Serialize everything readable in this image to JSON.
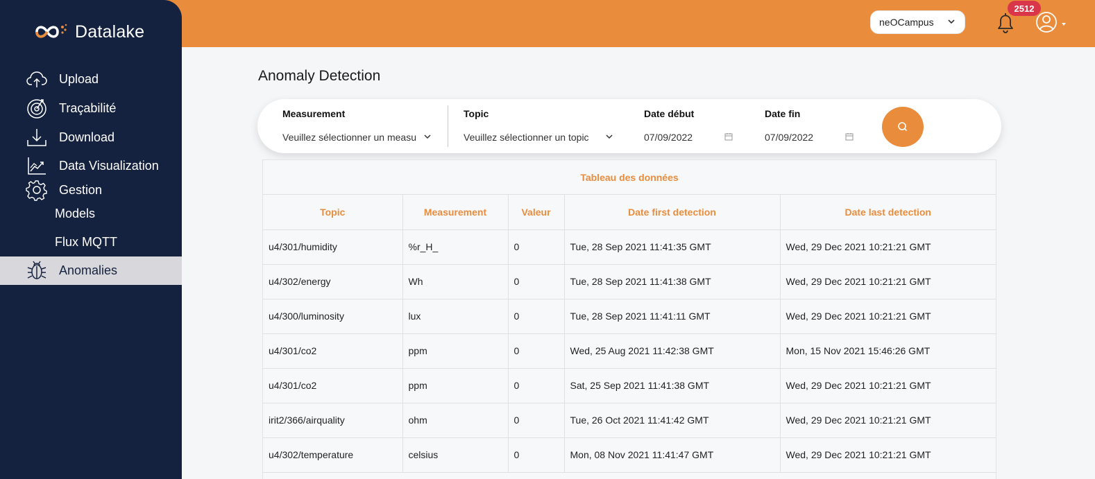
{
  "sidebar": {
    "logo_text": "Datalake",
    "items": [
      {
        "label": "Upload",
        "icon": "cloud-upload-icon"
      },
      {
        "label": "Traçabilité",
        "icon": "target-icon"
      },
      {
        "label": "Download",
        "icon": "download-icon"
      },
      {
        "label": "Data Visualization",
        "icon": "chart-icon"
      },
      {
        "label": "Gestion",
        "icon": "gear-icon"
      }
    ],
    "sub_items": [
      {
        "label": "Models"
      },
      {
        "label": "Flux MQTT"
      }
    ],
    "active_item": {
      "label": "Anomalies",
      "icon": "bug-icon"
    }
  },
  "header": {
    "org_select_value": "neOCampus",
    "notification_count": "2512"
  },
  "page": {
    "title": "Anomaly Detection"
  },
  "filters": {
    "measurement_label": "Measurement",
    "measurement_placeholder": "Veuillez sélectionner un measurement",
    "topic_label": "Topic",
    "topic_placeholder": "Veuillez sélectionner un topic",
    "date_start_label": "Date début",
    "date_start_value": "07/09/2022",
    "date_end_label": "Date fin",
    "date_end_value": "07/09/2022"
  },
  "table": {
    "caption": "Tableau des données",
    "headers": [
      "Topic",
      "Measurement",
      "Valeur",
      "Date first detection",
      "Date last detection"
    ],
    "rows": [
      [
        "u4/301/humidity",
        "%r_H_",
        "0",
        "Tue, 28 Sep 2021 11:41:35 GMT",
        "Wed, 29 Dec 2021 10:21:21 GMT"
      ],
      [
        "u4/302/energy",
        "Wh",
        "0",
        "Tue, 28 Sep 2021 11:41:38 GMT",
        "Wed, 29 Dec 2021 10:21:21 GMT"
      ],
      [
        "u4/300/luminosity",
        "lux",
        "0",
        "Tue, 28 Sep 2021 11:41:11 GMT",
        "Wed, 29 Dec 2021 10:21:21 GMT"
      ],
      [
        "u4/301/co2",
        "ppm",
        "0",
        "Wed, 25 Aug 2021 11:42:38 GMT",
        "Mon, 15 Nov 2021 15:46:26 GMT"
      ],
      [
        "u4/301/co2",
        "ppm",
        "0",
        "Sat, 25 Sep 2021 11:41:38 GMT",
        "Wed, 29 Dec 2021 10:21:21 GMT"
      ],
      [
        "irit2/366/airquality",
        "ohm",
        "0",
        "Tue, 26 Oct 2021 11:41:42 GMT",
        "Wed, 29 Dec 2021 10:21:21 GMT"
      ],
      [
        "u4/302/temperature",
        "celsius",
        "0",
        "Mon, 08 Nov 2021 11:41:47 GMT",
        "Wed, 29 Dec 2021 10:21:21 GMT"
      ]
    ]
  },
  "colors": {
    "accent": "#e98c3c",
    "sidebar": "#15223f",
    "badge": "#d9364a"
  }
}
